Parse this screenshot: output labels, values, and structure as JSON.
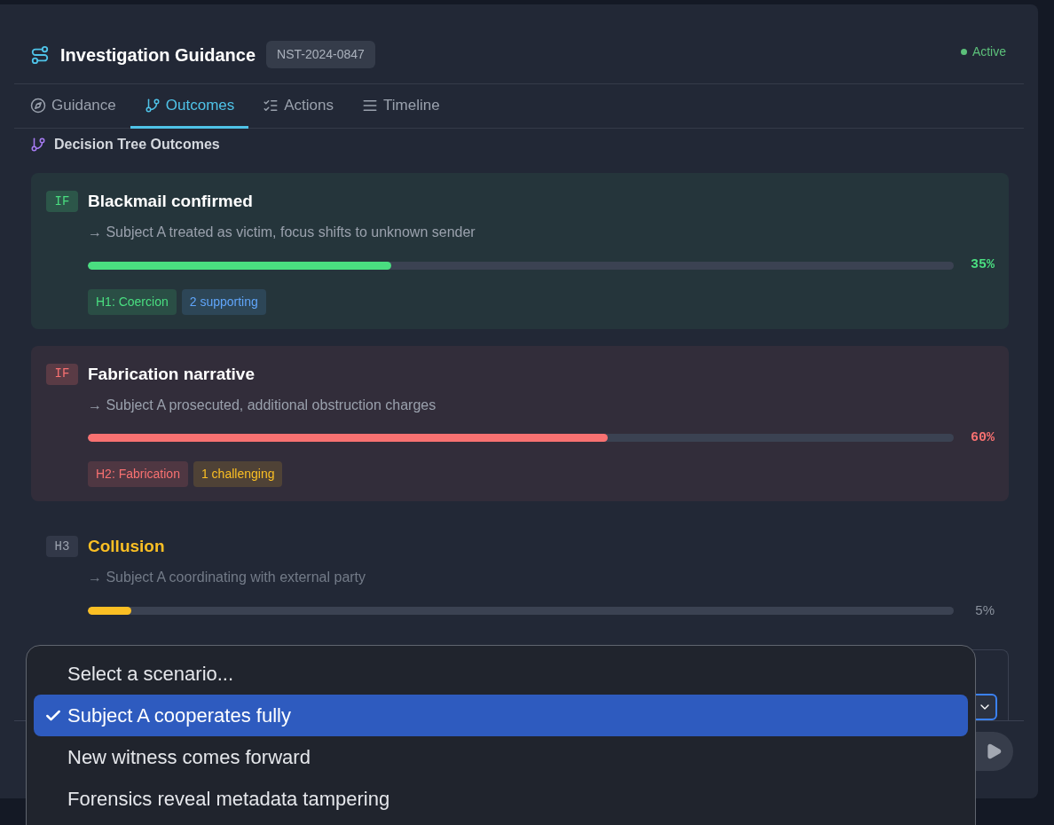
{
  "header": {
    "title": "Investigation Guidance",
    "case_id": "NST-2024-0847",
    "status": "Active"
  },
  "tabs": [
    {
      "label": "Guidance",
      "selected": false
    },
    {
      "label": "Outcomes",
      "selected": true
    },
    {
      "label": "Actions",
      "selected": false
    },
    {
      "label": "Timeline",
      "selected": false
    }
  ],
  "section_title": "Decision Tree Outcomes",
  "outcomes": [
    {
      "kind": "if",
      "badge": "IF",
      "title": "Blackmail confirmed",
      "result": "→ Subject A treated as victim, focus shifts to unknown sender",
      "level": 0.35,
      "percent": "35%",
      "color": "#4ade80",
      "tags": [
        {
          "label": "H1: Coercion",
          "color": "#4ade80"
        },
        {
          "label": "2 supporting",
          "color": "#60a5fa"
        }
      ]
    },
    {
      "kind": "if",
      "badge": "IF",
      "title": "Fabrication narrative",
      "result": "→ Subject A prosecuted, additional obstruction charges",
      "level": 0.6,
      "percent": "60%",
      "color": "#f87171",
      "tags": [
        {
          "label": "H2: Fabrication",
          "color": "#f87171"
        },
        {
          "label": "1 challenging",
          "color": "#fbbf24"
        }
      ]
    },
    {
      "kind": "hypothesis",
      "badge": "H3",
      "title": "Collusion",
      "result": "→ Subject A coordinating with external party",
      "level": 0.05,
      "percent": "5%",
      "color": "#fbbf24"
    }
  ],
  "scenario_select": {
    "expanded": true,
    "options": [
      {
        "label": "Select a scenario...",
        "selected": false
      },
      {
        "label": "Subject A cooperates fully",
        "selected": true
      },
      {
        "label": "New witness comes forward",
        "selected": false
      },
      {
        "label": "Forensics reveal metadata tampering",
        "selected": false
      }
    ]
  }
}
